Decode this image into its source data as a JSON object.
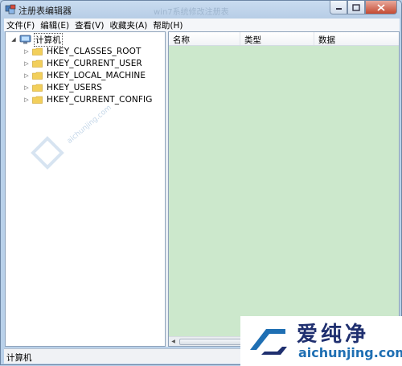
{
  "window": {
    "title": "注册表编辑器",
    "title_overlay": "win7系统修改注册表"
  },
  "menu": [
    "文件(F)",
    "编辑(E)",
    "查看(V)",
    "收藏夹(A)",
    "帮助(H)"
  ],
  "tree": {
    "root": "计算机",
    "hives": [
      "HKEY_CLASSES_ROOT",
      "HKEY_CURRENT_USER",
      "HKEY_LOCAL_MACHINE",
      "HKEY_USERS",
      "HKEY_CURRENT_CONFIG"
    ]
  },
  "list": {
    "columns": [
      "名称",
      "类型",
      "数据"
    ]
  },
  "status": "计算机",
  "watermark": {
    "brand_cn": "爱纯净",
    "brand_en": "aichunjing.com",
    "small_text": "aichunjing.com"
  },
  "icons": {
    "app": "regedit-icon",
    "computer": "computer-icon",
    "folder": "folder-icon"
  },
  "colors": {
    "list_background": "#cce8cc",
    "folder": "#f2cf5b",
    "close_button": "#c44a32"
  }
}
